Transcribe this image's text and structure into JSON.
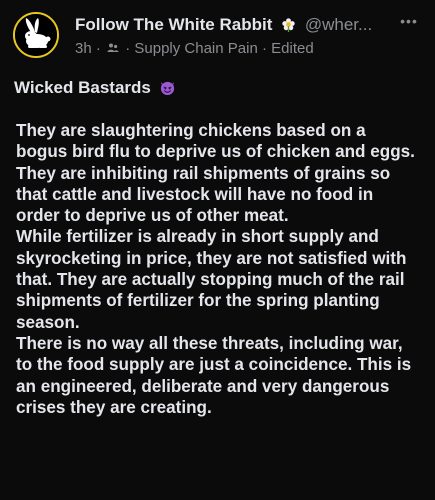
{
  "post": {
    "author_name": "Follow The White Rabbit",
    "handle": "@wher...",
    "time_ago": "3h",
    "separator": "·",
    "group_name": "Supply Chain Pain",
    "edited_label": "Edited",
    "more_label": "•••",
    "title": "Wicked Bastards",
    "body_paragraphs": [
      "They are slaughtering chickens based on a bogus bird flu to deprive us of chicken and eggs.",
      "They are inhibiting rail shipments of grains so that cattle and livestock will have no food in order to deprive us of other meat.",
      "While fertilizer is already in short supply and skyrocketing in price, they are not satisfied with that. They are actually stopping much of the rail shipments of fertilizer for the spring planting season.",
      "There is no way all these threats, including war, to the food supply are just a coincidence. This is an engineered, deliberate and very dangerous crises they are creating."
    ]
  },
  "icons": {
    "avatar": "white-rabbit-silhouette",
    "author_badge": "flower-icon",
    "audience": "group-icon",
    "title_emoji": "smiling-devil-icon"
  },
  "colors": {
    "background": "#0b0b0b",
    "text_primary": "#e4e6eb",
    "text_secondary": "#8a8d91",
    "avatar_border": "#e7c81f",
    "devil_purple": "#9b59d0"
  }
}
